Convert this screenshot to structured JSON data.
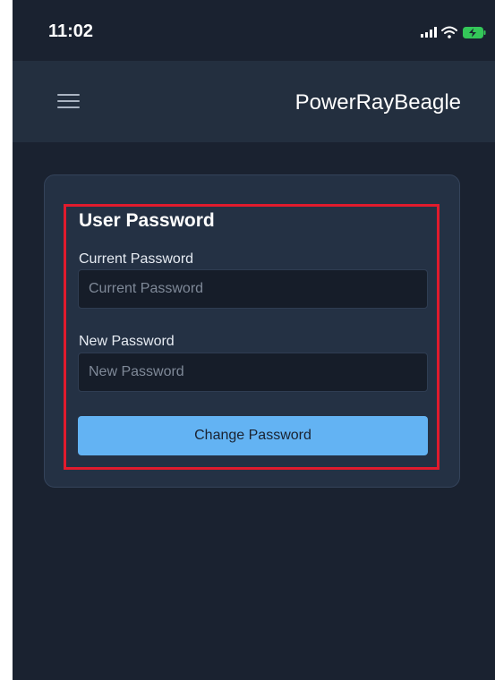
{
  "status_bar": {
    "time": "11:02",
    "icons": [
      "signal-icon",
      "wifi-icon",
      "battery-charging-icon"
    ]
  },
  "header": {
    "menu_icon": "hamburger-menu-icon",
    "title": "PowerRayBeagle"
  },
  "form": {
    "title": "User Password",
    "current_password": {
      "label": "Current Password",
      "placeholder": "Current Password",
      "value": ""
    },
    "new_password": {
      "label": "New Password",
      "placeholder": "New Password",
      "value": ""
    },
    "submit_label": "Change Password"
  },
  "colors": {
    "background": "#1a2230",
    "header": "#232f3f",
    "card": "#243144",
    "input": "#161d29",
    "button": "#63b3f3",
    "highlight": "#e11b2d"
  }
}
